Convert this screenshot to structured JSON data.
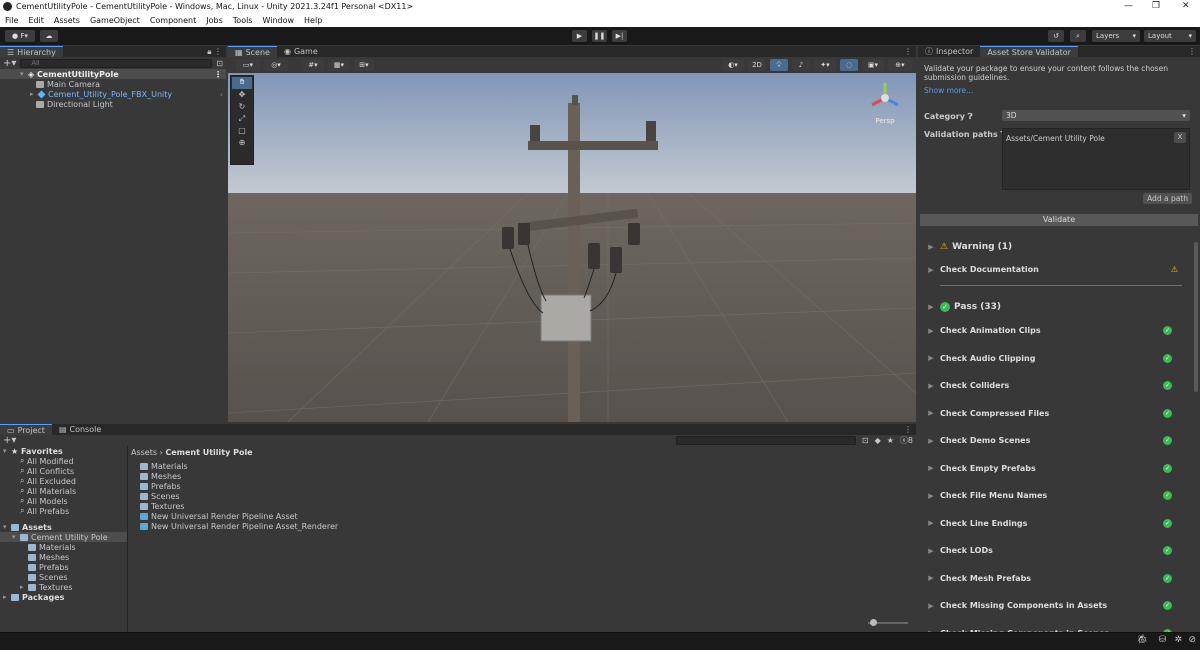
{
  "window": {
    "title": "CementUtilityPole - CementUtilityPole - Windows, Mac, Linux - Unity 2021.3.24f1 Personal <DX11>"
  },
  "menu": [
    "File",
    "Edit",
    "Assets",
    "GameObject",
    "Component",
    "Jobs",
    "Tools",
    "Window",
    "Help"
  ],
  "toolbar": {
    "account": "F",
    "layers": "Layers",
    "layout": "Layout"
  },
  "hierarchy": {
    "tab": "Hierarchy",
    "search_placeholder": "All",
    "scene": "CementUtilityPole",
    "items": [
      "Main Camera",
      "Cement_Utility_Pole_FBX_Unity",
      "Directional Light"
    ]
  },
  "scene_tabs": {
    "scene": "Scene",
    "game": "Game",
    "two_d": "2D",
    "persp": "Persp"
  },
  "project": {
    "tab_project": "Project",
    "tab_console": "Console",
    "favorites": "Favorites",
    "fav_items": [
      "All Modified",
      "All Conflicts",
      "All Excluded",
      "All Materials",
      "All Models",
      "All Prefabs"
    ],
    "assets": "Assets",
    "asset_root": "Cement Utility Pole",
    "asset_children": [
      "Materials",
      "Meshes",
      "Prefabs",
      "Scenes",
      "Textures"
    ],
    "packages": "Packages",
    "breadcrumb_root": "Assets",
    "breadcrumb_current": "Cement Utility Pole",
    "files": [
      "Materials",
      "Meshes",
      "Prefabs",
      "Scenes",
      "Textures",
      "New Universal Render Pipeline Asset",
      "New Universal Render Pipeline Asset_Renderer"
    ],
    "hidden_count": "8"
  },
  "inspector": {
    "tab_inspector": "Inspector",
    "tab_validator": "Asset Store Validator",
    "intro": "Validate your package to ensure your content follows the chosen submission guidelines.",
    "show_more": "Show more...",
    "category_label": "Category",
    "category_value": "3D",
    "paths_label": "Validation paths",
    "path_value": "Assets/Cement Utility Pole",
    "remove": "X",
    "add_path": "Add a path",
    "validate": "Validate",
    "warning_header": "Warning (1)",
    "warning_items": [
      "Check Documentation"
    ],
    "pass_header": "Pass (33)",
    "pass_items": [
      "Check Animation Clips",
      "Check Audio Clipping",
      "Check Colliders",
      "Check Compressed Files",
      "Check Demo Scenes",
      "Check Empty Prefabs",
      "Check File Menu Names",
      "Check Line Endings",
      "Check LODs",
      "Check Mesh Prefabs",
      "Check Missing Components in Assets",
      "Check Missing Components in Scenes"
    ]
  }
}
